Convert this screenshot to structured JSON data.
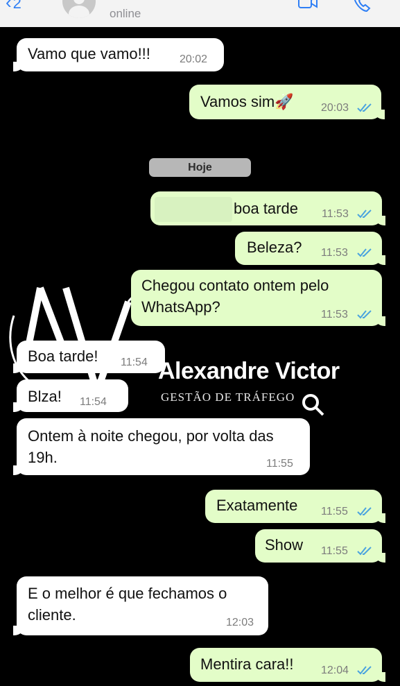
{
  "header": {
    "back_count": "2",
    "contact_status": "online"
  },
  "icons": {
    "back": "chevron-left-icon",
    "avatar": "person-icon",
    "video": "video-camera-icon",
    "call": "phone-icon",
    "read": "double-check-icon",
    "search": "magnifier-icon"
  },
  "colors": {
    "incoming_bubble": "#ffffff",
    "outgoing_bubble": "#e3fdc8",
    "read_check": "#4aa3df",
    "accent": "#2f7ff5"
  },
  "day_separator": "Hoje",
  "messages": [
    {
      "direction": "in",
      "text": "Vamo que vamo!!!",
      "time": "20:02"
    },
    {
      "direction": "out",
      "text": "Vamos sim🚀",
      "time": "20:03",
      "read": true
    },
    {
      "direction": "out",
      "text": "boa tarde",
      "time": "11:53",
      "read": true
    },
    {
      "direction": "out",
      "text": "Beleza?",
      "time": "11:53",
      "read": true
    },
    {
      "direction": "out",
      "text": "Chegou contato ontem pelo WhatsApp?",
      "time": "11:53",
      "read": true
    },
    {
      "direction": "in",
      "text": "Boa tarde!",
      "time": "11:54"
    },
    {
      "direction": "in",
      "text": "Blza!",
      "time": "11:54"
    },
    {
      "direction": "in",
      "text": "Ontem à noite chegou, por volta das 19h.",
      "time": "11:55"
    },
    {
      "direction": "out",
      "text": "Exatamente",
      "time": "11:55",
      "read": true
    },
    {
      "direction": "out",
      "text": "Show",
      "time": "11:55",
      "read": true
    },
    {
      "direction": "in",
      "text": "E o melhor é que fechamos o cliente.",
      "time": "12:03"
    },
    {
      "direction": "out",
      "text": "Mentira cara!!",
      "time": "12:04",
      "read": true
    }
  ],
  "watermark": {
    "name": "Alexandre Victor",
    "tagline": "GESTÃO DE TRÁFEGO"
  }
}
